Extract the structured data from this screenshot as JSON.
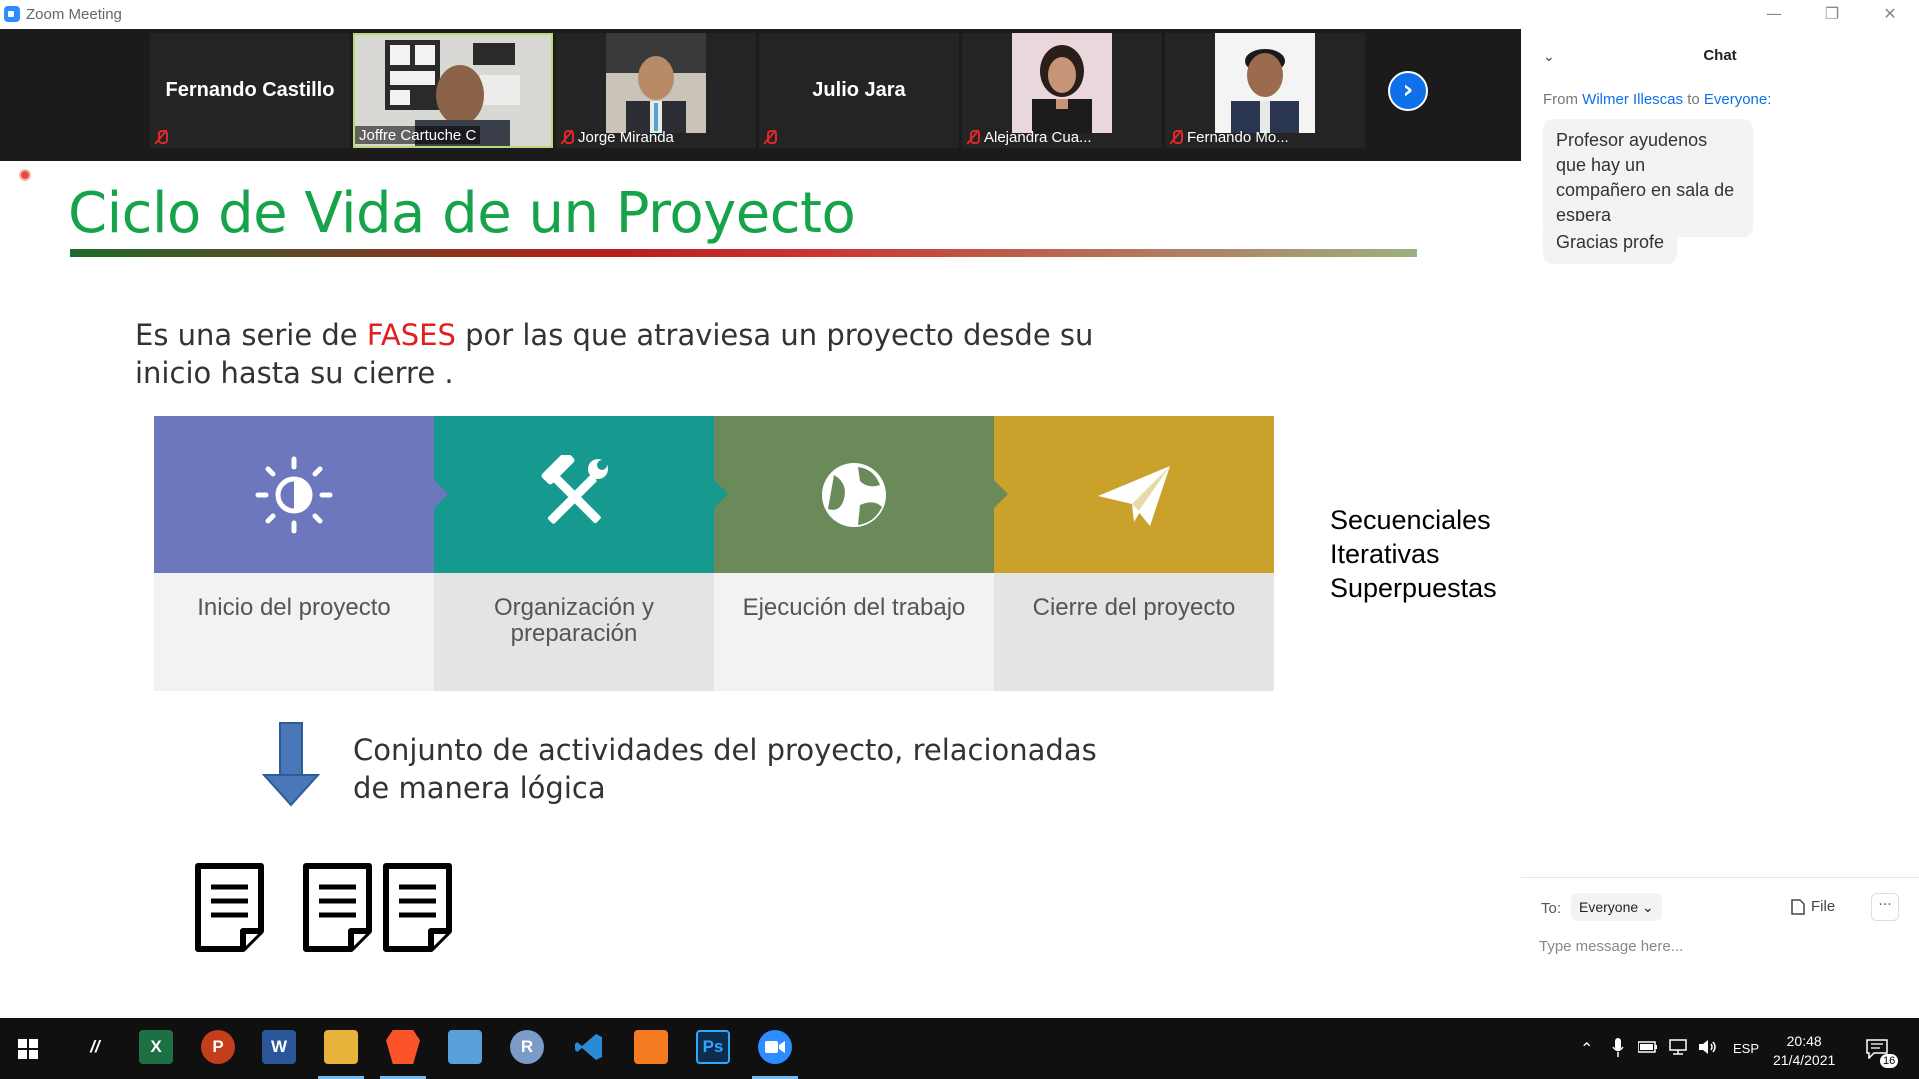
{
  "window": {
    "title": "Zoom Meeting",
    "controls": {
      "minimize": "—",
      "restore": "❐",
      "close": "✕"
    }
  },
  "participants": [
    {
      "name": "Fernando Castillo",
      "video": false
    },
    {
      "name": "Joffre Cartuche C",
      "video": true,
      "active": true
    },
    {
      "name": "Jorge Miranda",
      "video": true
    },
    {
      "name": "Julio Jara",
      "video": false
    },
    {
      "name": "Alejandra Cua...",
      "video": true
    },
    {
      "name": "Fernando Mo...",
      "video": true
    }
  ],
  "slide": {
    "title": "Ciclo de Vida de un Proyecto",
    "intro_pre": "Es una serie de ",
    "intro_highlight": "FASES",
    "intro_post": " por las que atraviesa un proyecto desde su inicio hasta su cierre .",
    "phases": [
      {
        "label": "Inicio del proyecto",
        "color": "#6c77bd",
        "icon": "sun-icon"
      },
      {
        "label": "Organización y preparación",
        "color": "#169a8f",
        "icon": "tools-icon"
      },
      {
        "label": "Ejecución del trabajo",
        "color": "#6b8a5a",
        "icon": "globe-icon"
      },
      {
        "label": "Cierre del proyecto",
        "color": "#c9a12b",
        "icon": "paper-plane-icon"
      }
    ],
    "types": [
      "Secuenciales",
      "Iterativas",
      "Superpuestas"
    ],
    "activities_text": "Conjunto de actividades del proyecto, relacionadas de manera lógica"
  },
  "chat": {
    "header": "Chat",
    "from_label": "From",
    "from_sender": "Wilmer Illescas",
    "to_word": "to",
    "to_recipient": "Everyone:",
    "messages": [
      "Profesor ayudenos que hay un compañero en sala de espera",
      "Gracias profe"
    ],
    "to_label": "To:",
    "to_selected": "Everyone",
    "file_label": "File",
    "more_label": "···",
    "input_placeholder": "Type message here..."
  },
  "taskbar": {
    "apps": [
      {
        "name": "start-icon",
        "glyph": ""
      },
      {
        "name": "app-slash-icon",
        "glyph": "//"
      },
      {
        "name": "excel-icon",
        "glyph": "X",
        "color": "#1d7044"
      },
      {
        "name": "powerpoint-icon",
        "glyph": "P",
        "color": "#c43e1c"
      },
      {
        "name": "word-icon",
        "glyph": "W",
        "color": "#2b579a"
      },
      {
        "name": "file-explorer-icon",
        "glyph": "",
        "color": "#e8b33a"
      },
      {
        "name": "brave-icon",
        "glyph": "",
        "color": "#fb542b"
      },
      {
        "name": "contact-card-icon",
        "glyph": "",
        "color": "#5aa0d8"
      },
      {
        "name": "r-icon",
        "glyph": "R",
        "color": "#7b9cc8"
      },
      {
        "name": "vscode-icon",
        "glyph": "",
        "color": "#2a8ad4"
      },
      {
        "name": "xampp-icon",
        "glyph": "",
        "color": "#f47b20"
      },
      {
        "name": "photoshop-icon",
        "glyph": "Ps",
        "color": "#0c2d4d"
      },
      {
        "name": "zoom-icon",
        "glyph": "",
        "color": "#2d8cff"
      }
    ],
    "language": "ESP",
    "time": "20:48",
    "date": "21/4/2021",
    "notifications": "16"
  }
}
